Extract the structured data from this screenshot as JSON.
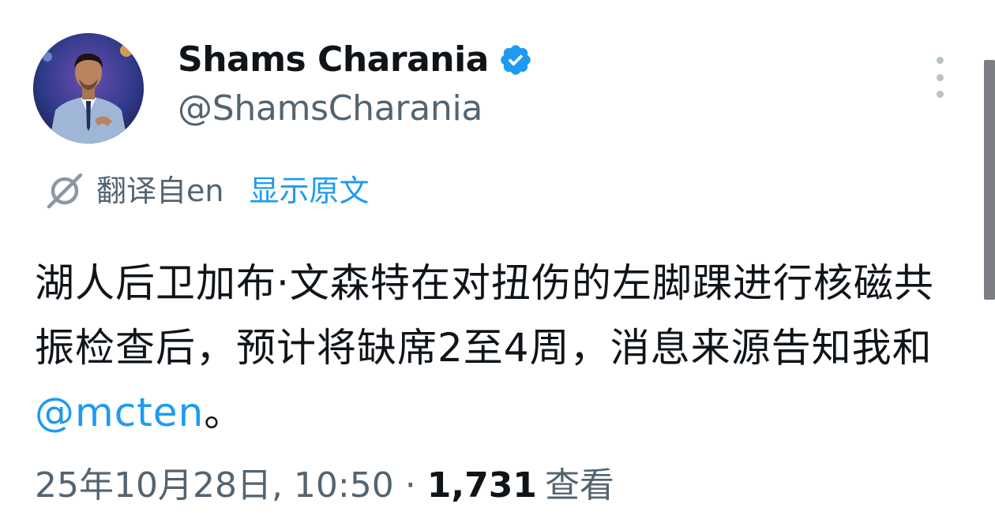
{
  "author": {
    "display_name": "Shams Charania",
    "handle": "@ShamsCharania",
    "verified": true,
    "avatar_icon": "profile-photo"
  },
  "translation": {
    "translated_from": "翻译自en",
    "show_original": "显示原文",
    "icon": "translate-icon"
  },
  "tweet": {
    "text_before_mention": "湖人后卫加布·文森特在对扭伤的左脚踝进行核磁共振检查后，预计将缺席2至4周，消息来源告知我和",
    "mention": "@mcten",
    "text_after_mention": "。"
  },
  "meta": {
    "timestamp": "25年10月28日, 10:50",
    "separator": "·",
    "views_count": "1,731",
    "views_label": "查看"
  },
  "colors": {
    "link": "#1d9bf0",
    "secondary_text": "#536471",
    "primary_text": "#0f1419",
    "verified_badge": "#1d9bf0"
  }
}
